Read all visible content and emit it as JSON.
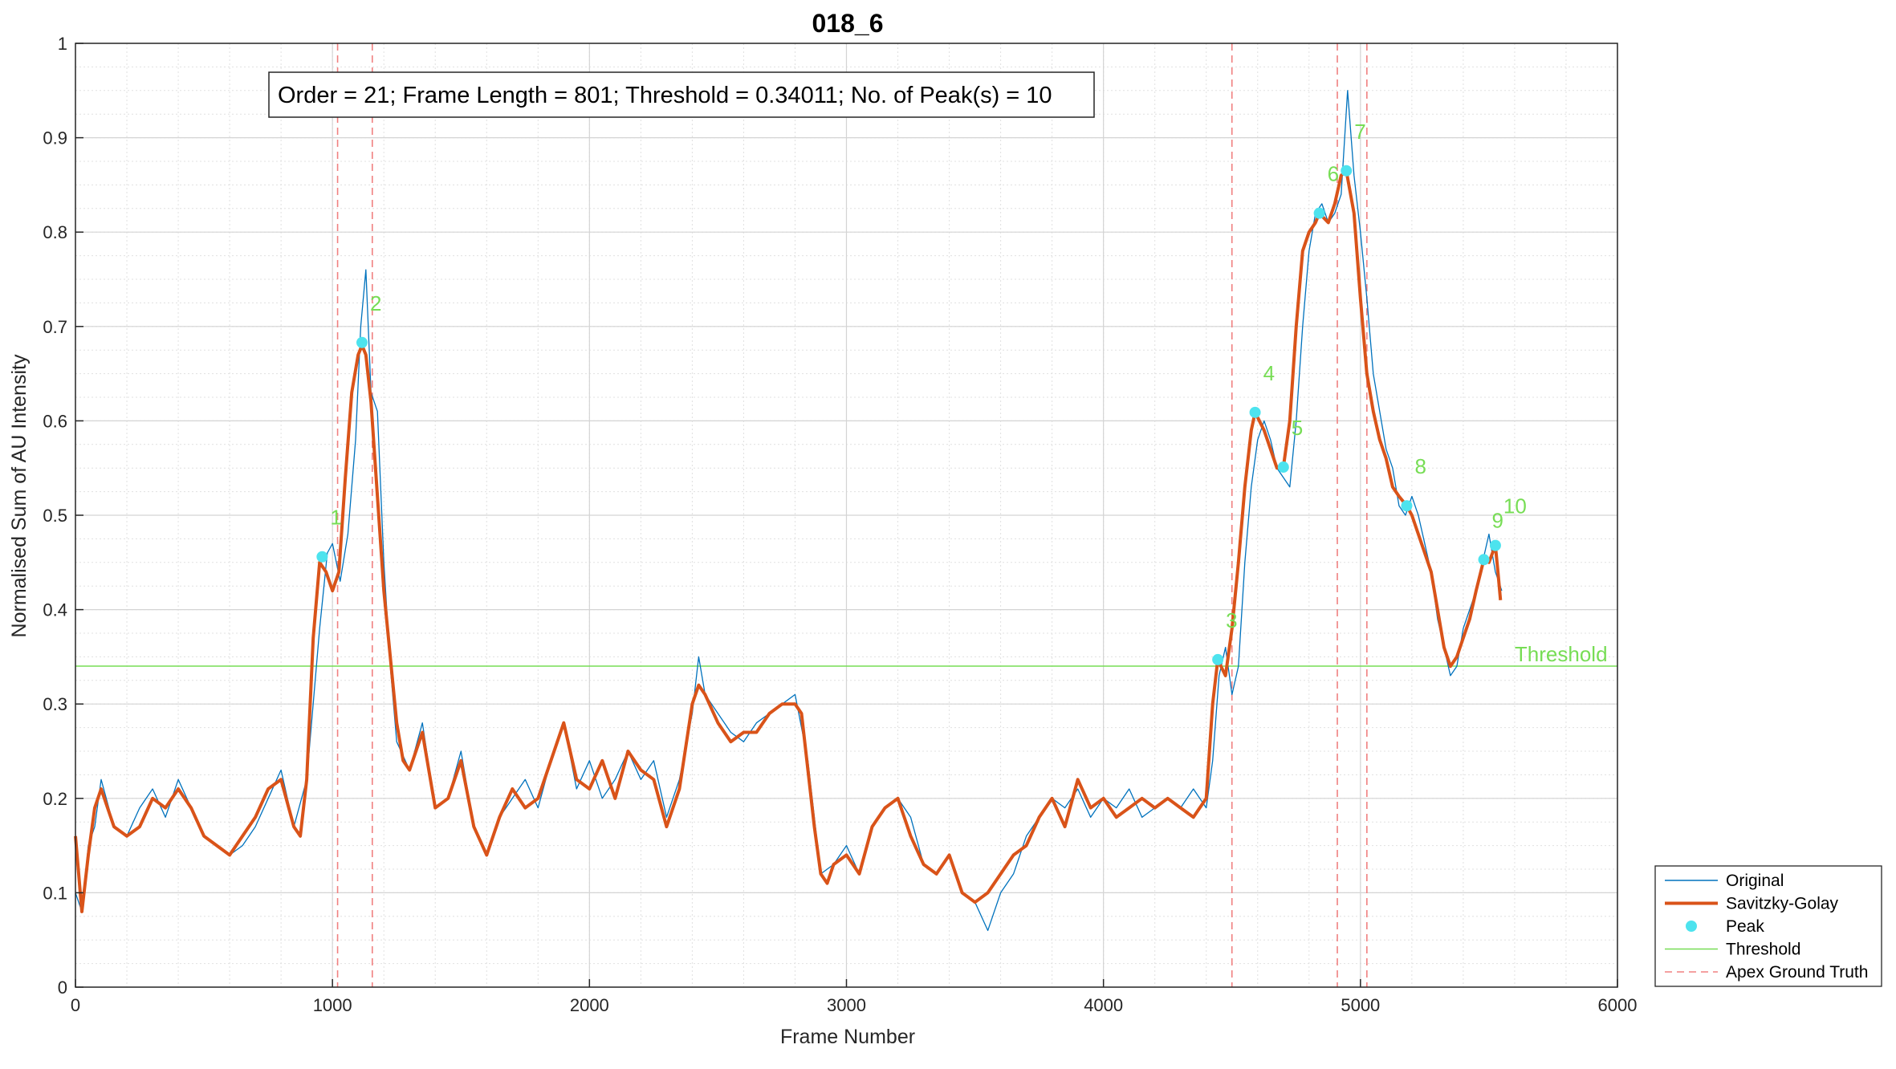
{
  "chart_data": {
    "type": "line",
    "title": "018_6",
    "xlabel": "Frame Number",
    "ylabel": "Normalised Sum of AU Intensity",
    "xlim": [
      0,
      6000
    ],
    "ylim": [
      0,
      1
    ],
    "xticks": [
      0,
      1000,
      2000,
      3000,
      4000,
      5000,
      6000
    ],
    "yticks": [
      0,
      0.1,
      0.2,
      0.3,
      0.4,
      0.5,
      0.6,
      0.7,
      0.8,
      0.9,
      1
    ],
    "grid": true,
    "minor_grid": true,
    "legend_position": "outside-bottom-right",
    "info_text": "Order = 21; Frame Length = 801; Threshold = 0.34011; No. of Peak(s) = 10",
    "threshold": 0.34011,
    "threshold_label": "Threshold",
    "apex_ground_truth": [
      1020,
      1155,
      4500,
      4910,
      5025
    ],
    "peaks": [
      {
        "label": "1",
        "x": 960,
        "y": 0.456
      },
      {
        "label": "2",
        "x": 1115,
        "y": 0.683
      },
      {
        "label": "3",
        "x": 4445,
        "y": 0.347
      },
      {
        "label": "4",
        "x": 4590,
        "y": 0.609
      },
      {
        "label": "5",
        "x": 4700,
        "y": 0.551
      },
      {
        "label": "6",
        "x": 4840,
        "y": 0.82
      },
      {
        "label": "7",
        "x": 4945,
        "y": 0.865
      },
      {
        "label": "8",
        "x": 5180,
        "y": 0.51
      },
      {
        "label": "9",
        "x": 5480,
        "y": 0.453
      },
      {
        "label": "10",
        "x": 5525,
        "y": 0.468
      }
    ],
    "series": [
      {
        "name": "Original",
        "color": "#0072BD",
        "x": [
          0,
          25,
          50,
          75,
          100,
          150,
          200,
          250,
          300,
          350,
          400,
          450,
          500,
          550,
          600,
          650,
          700,
          750,
          800,
          850,
          900,
          950,
          980,
          1000,
          1030,
          1060,
          1090,
          1110,
          1130,
          1150,
          1175,
          1200,
          1225,
          1250,
          1300,
          1350,
          1400,
          1450,
          1500,
          1550,
          1600,
          1650,
          1700,
          1750,
          1800,
          1850,
          1900,
          1950,
          2000,
          2050,
          2100,
          2150,
          2200,
          2250,
          2300,
          2350,
          2400,
          2425,
          2450,
          2500,
          2550,
          2600,
          2650,
          2700,
          2750,
          2800,
          2850,
          2875,
          2900,
          2950,
          3000,
          3050,
          3100,
          3150,
          3200,
          3250,
          3300,
          3350,
          3400,
          3450,
          3500,
          3550,
          3600,
          3650,
          3700,
          3750,
          3800,
          3850,
          3900,
          3950,
          4000,
          4050,
          4100,
          4150,
          4200,
          4250,
          4300,
          4350,
          4400,
          4425,
          4450,
          4475,
          4500,
          4525,
          4550,
          4575,
          4600,
          4625,
          4650,
          4675,
          4700,
          4725,
          4750,
          4775,
          4800,
          4825,
          4850,
          4875,
          4900,
          4925,
          4950,
          4975,
          5000,
          5025,
          5050,
          5075,
          5100,
          5125,
          5150,
          5175,
          5200,
          5225,
          5250,
          5275,
          5300,
          5325,
          5350,
          5375,
          5400,
          5425,
          5450,
          5475,
          5500,
          5525,
          5550
        ],
        "y": [
          0.1,
          0.08,
          0.15,
          0.17,
          0.22,
          0.17,
          0.16,
          0.19,
          0.21,
          0.18,
          0.22,
          0.19,
          0.16,
          0.15,
          0.14,
          0.15,
          0.17,
          0.2,
          0.23,
          0.17,
          0.22,
          0.38,
          0.46,
          0.47,
          0.43,
          0.48,
          0.58,
          0.7,
          0.76,
          0.63,
          0.61,
          0.45,
          0.34,
          0.26,
          0.23,
          0.28,
          0.19,
          0.2,
          0.25,
          0.17,
          0.14,
          0.18,
          0.2,
          0.22,
          0.19,
          0.24,
          0.28,
          0.21,
          0.24,
          0.2,
          0.22,
          0.25,
          0.22,
          0.24,
          0.18,
          0.22,
          0.29,
          0.35,
          0.31,
          0.29,
          0.27,
          0.26,
          0.28,
          0.29,
          0.3,
          0.31,
          0.24,
          0.18,
          0.12,
          0.13,
          0.15,
          0.12,
          0.17,
          0.19,
          0.2,
          0.18,
          0.13,
          0.12,
          0.14,
          0.1,
          0.09,
          0.06,
          0.1,
          0.12,
          0.16,
          0.18,
          0.2,
          0.19,
          0.21,
          0.18,
          0.2,
          0.19,
          0.21,
          0.18,
          0.19,
          0.2,
          0.19,
          0.21,
          0.19,
          0.24,
          0.33,
          0.36,
          0.31,
          0.34,
          0.45,
          0.53,
          0.58,
          0.6,
          0.58,
          0.55,
          0.54,
          0.53,
          0.6,
          0.7,
          0.78,
          0.82,
          0.83,
          0.81,
          0.82,
          0.84,
          0.95,
          0.86,
          0.8,
          0.73,
          0.65,
          0.61,
          0.57,
          0.55,
          0.51,
          0.5,
          0.52,
          0.5,
          0.47,
          0.44,
          0.39,
          0.36,
          0.33,
          0.34,
          0.38,
          0.4,
          0.42,
          0.45,
          0.48,
          0.44,
          0.42
        ]
      },
      {
        "name": "Savitzky-Golay",
        "color": "#D95319",
        "x": [
          0,
          25,
          50,
          75,
          100,
          125,
          150,
          200,
          250,
          300,
          350,
          400,
          450,
          500,
          550,
          600,
          650,
          700,
          750,
          800,
          850,
          875,
          900,
          925,
          950,
          975,
          1000,
          1025,
          1050,
          1075,
          1100,
          1115,
          1130,
          1150,
          1175,
          1200,
          1225,
          1250,
          1275,
          1300,
          1350,
          1400,
          1450,
          1500,
          1550,
          1600,
          1650,
          1700,
          1750,
          1800,
          1850,
          1900,
          1950,
          2000,
          2050,
          2100,
          2150,
          2200,
          2250,
          2300,
          2350,
          2400,
          2425,
          2450,
          2500,
          2550,
          2600,
          2650,
          2700,
          2750,
          2800,
          2825,
          2850,
          2875,
          2900,
          2925,
          2950,
          3000,
          3050,
          3100,
          3150,
          3200,
          3250,
          3300,
          3350,
          3400,
          3450,
          3500,
          3550,
          3600,
          3650,
          3700,
          3750,
          3800,
          3850,
          3900,
          3950,
          4000,
          4050,
          4100,
          4150,
          4200,
          4250,
          4300,
          4350,
          4400,
          4425,
          4445,
          4475,
          4500,
          4525,
          4550,
          4575,
          4590,
          4625,
          4650,
          4675,
          4700,
          4725,
          4750,
          4775,
          4800,
          4825,
          4840,
          4875,
          4900,
          4925,
          4945,
          4975,
          5000,
          5025,
          5050,
          5075,
          5100,
          5125,
          5150,
          5180,
          5200,
          5225,
          5250,
          5275,
          5300,
          5325,
          5350,
          5375,
          5400,
          5425,
          5450,
          5480,
          5500,
          5525,
          5535,
          5545
        ],
        "y": [
          0.16,
          0.08,
          0.14,
          0.19,
          0.21,
          0.19,
          0.17,
          0.16,
          0.17,
          0.2,
          0.19,
          0.21,
          0.19,
          0.16,
          0.15,
          0.14,
          0.16,
          0.18,
          0.21,
          0.22,
          0.17,
          0.16,
          0.22,
          0.37,
          0.45,
          0.44,
          0.42,
          0.44,
          0.54,
          0.63,
          0.67,
          0.68,
          0.67,
          0.62,
          0.52,
          0.42,
          0.35,
          0.28,
          0.24,
          0.23,
          0.27,
          0.19,
          0.2,
          0.24,
          0.17,
          0.14,
          0.18,
          0.21,
          0.19,
          0.2,
          0.24,
          0.28,
          0.22,
          0.21,
          0.24,
          0.2,
          0.25,
          0.23,
          0.22,
          0.17,
          0.21,
          0.3,
          0.32,
          0.31,
          0.28,
          0.26,
          0.27,
          0.27,
          0.29,
          0.3,
          0.3,
          0.29,
          0.23,
          0.17,
          0.12,
          0.11,
          0.13,
          0.14,
          0.12,
          0.17,
          0.19,
          0.2,
          0.16,
          0.13,
          0.12,
          0.14,
          0.1,
          0.09,
          0.1,
          0.12,
          0.14,
          0.15,
          0.18,
          0.2,
          0.17,
          0.22,
          0.19,
          0.2,
          0.18,
          0.19,
          0.2,
          0.19,
          0.2,
          0.19,
          0.18,
          0.2,
          0.3,
          0.347,
          0.33,
          0.38,
          0.45,
          0.53,
          0.59,
          0.609,
          0.59,
          0.57,
          0.55,
          0.551,
          0.6,
          0.7,
          0.78,
          0.8,
          0.81,
          0.82,
          0.81,
          0.83,
          0.86,
          0.865,
          0.82,
          0.73,
          0.65,
          0.61,
          0.58,
          0.56,
          0.53,
          0.52,
          0.51,
          0.5,
          0.48,
          0.46,
          0.44,
          0.4,
          0.36,
          0.34,
          0.35,
          0.37,
          0.39,
          0.42,
          0.453,
          0.45,
          0.468,
          0.44,
          0.41
        ]
      }
    ],
    "legend": [
      {
        "label": "Original",
        "kind": "line",
        "color": "#0072BD"
      },
      {
        "label": "Savitzky-Golay",
        "kind": "thick-line",
        "color": "#D95319"
      },
      {
        "label": "Peak",
        "kind": "marker",
        "color": "#4DE3EE"
      },
      {
        "label": "Threshold",
        "kind": "line",
        "color": "#77DD55"
      },
      {
        "label": "Apex Ground Truth",
        "kind": "dashed",
        "color": "#F08080"
      }
    ]
  }
}
